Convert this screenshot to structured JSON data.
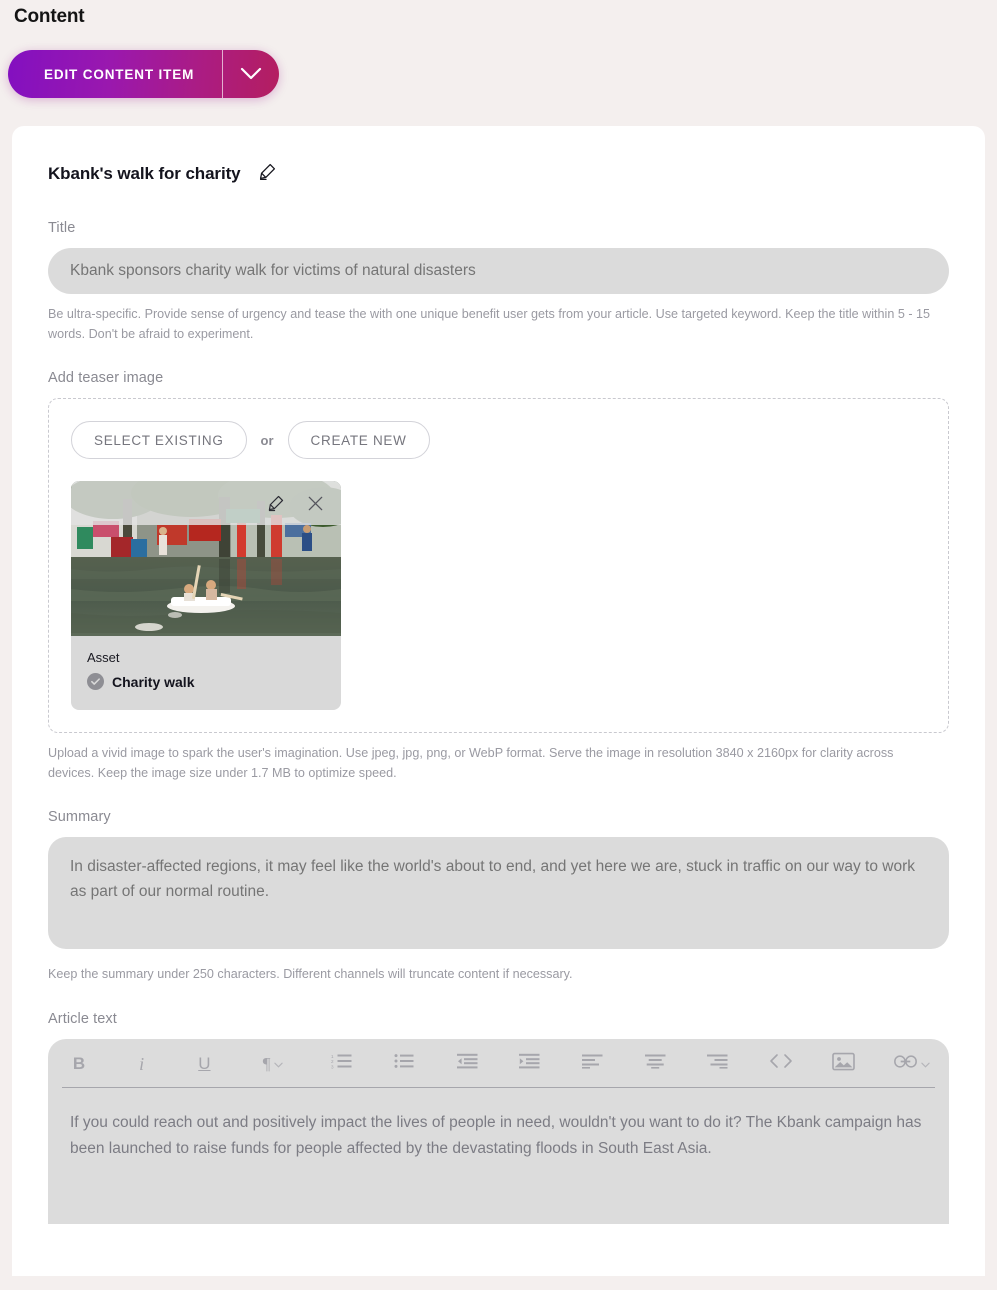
{
  "header": {
    "title": "Content"
  },
  "toolbar": {
    "primary_label": "EDIT CONTENT ITEM",
    "caret_icon": "chevron-down-icon",
    "gradient_from": "#8310C0",
    "gradient_to": "#B41E60"
  },
  "item": {
    "name": "Kbank's walk for charity",
    "edit_icon": "pencil-icon"
  },
  "fields": {
    "title": {
      "label": "Title",
      "value": "Kbank sponsors charity walk for victims of natural disasters",
      "placeholder": "Kbank sponsors charity walk for victims of natural disasters",
      "helper": "Be ultra-specific. Provide sense of urgency and tease the with one unique benefit user gets from your article. Use targeted keyword. Keep the title within 5 - 15 words. Don't be afraid to experiment."
    },
    "teaser_image": {
      "label": "Add teaser image",
      "select_existing_label": "SELECT EXISTING",
      "or_label": "or",
      "create_new_label": "CREATE NEW",
      "helper": "Upload a vivid image to spark the user's imagination. Use jpeg, jpg, png, or WebP format. Serve the image in resolution 3840 x 2160px for clarity across devices. Keep the image size under 1.7 MB to optimize speed.",
      "asset": {
        "meta_label": "Asset",
        "name": "Charity walk",
        "status_icon": "check-circle-icon",
        "edit_icon": "pencil-icon",
        "remove_icon": "close-icon",
        "thumbnail_alt": "flooded street with people on a small boat"
      }
    },
    "summary": {
      "label": "Summary",
      "value": "In disaster-affected regions, it may feel like the world's about to end, and yet here we are, stuck in traffic on our way to work as part of our normal routine.",
      "placeholder": "In disaster-affected regions, it may feel like the world's about to end, and yet here we are, stuck in traffic on our way to work as part of our normal routine.",
      "helper": "Keep the summary under 250 characters. Different channels will truncate content if necessary."
    },
    "article_text": {
      "label": "Article text",
      "value": "If you could reach out and positively impact the lives of people in need, wouldn't you want to do it? The Kbank campaign has been launched to raise funds for people affected by the devastating floods in South East Asia.",
      "editor_buttons": [
        {
          "name": "bold-icon",
          "glyph": "B"
        },
        {
          "name": "italic-icon",
          "glyph": "i"
        },
        {
          "name": "underline-icon",
          "glyph": "U"
        },
        {
          "name": "paragraph-style-icon",
          "glyph": "¶"
        },
        {
          "name": "numbered-list-icon",
          "glyph": ""
        },
        {
          "name": "bulleted-list-icon",
          "glyph": ""
        },
        {
          "name": "outdent-icon",
          "glyph": ""
        },
        {
          "name": "indent-icon",
          "glyph": ""
        },
        {
          "name": "align-left-icon",
          "glyph": ""
        },
        {
          "name": "align-center-icon",
          "glyph": ""
        },
        {
          "name": "align-right-icon",
          "glyph": ""
        },
        {
          "name": "code-icon",
          "glyph": "<>"
        },
        {
          "name": "insert-image-icon",
          "glyph": ""
        },
        {
          "name": "insert-link-icon",
          "glyph": ""
        }
      ]
    }
  }
}
